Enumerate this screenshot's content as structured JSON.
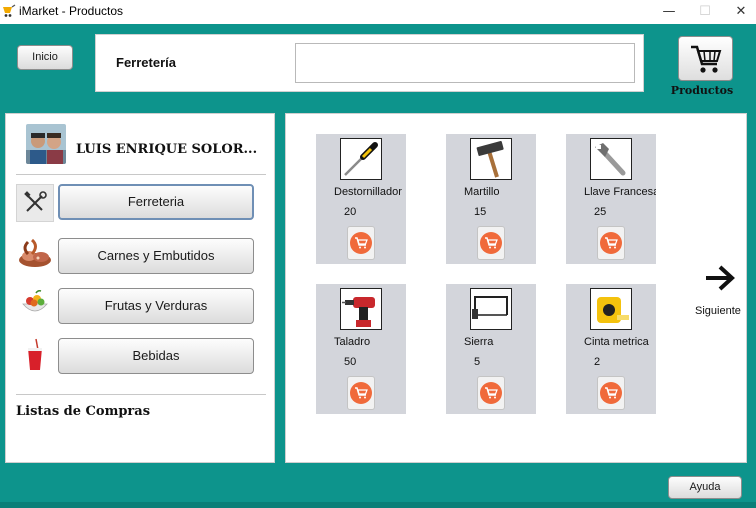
{
  "window": {
    "title": "iMarket - Productos",
    "minimize": "—",
    "maximize": "☐",
    "close": "✕"
  },
  "header": {
    "home_button": "Inicio",
    "section_title": "Ferretería",
    "search_value": "",
    "cart_label": "Productos"
  },
  "sidebar": {
    "user_name": "LUIS ENRIQUE  SOLOR...",
    "categories": [
      {
        "label": "Ferreteria",
        "icon": "tools-icon",
        "active": true
      },
      {
        "label": "Carnes y Embutidos",
        "icon": "meat-icon",
        "active": false
      },
      {
        "label": "Frutas y Verduras",
        "icon": "fruits-icon",
        "active": false
      },
      {
        "label": "Bebidas",
        "icon": "drink-icon",
        "active": false
      }
    ],
    "lists_title": "Listas de Compras"
  },
  "products": [
    {
      "name": "Destornillador",
      "qty": "20",
      "icon": "screwdriver-icon"
    },
    {
      "name": "Martillo",
      "qty": "15",
      "icon": "hammer-icon"
    },
    {
      "name": "Llave Francesa",
      "qty": "25",
      "icon": "wrench-icon"
    },
    {
      "name": "Taladro",
      "qty": "50",
      "icon": "drill-icon"
    },
    {
      "name": "Sierra",
      "qty": "5",
      "icon": "saw-icon"
    },
    {
      "name": "Cinta metrica",
      "qty": "2",
      "icon": "tape-measure-icon"
    }
  ],
  "navigation": {
    "next_label": "Siguiente"
  },
  "footer": {
    "help_button": "Ayuda"
  },
  "colors": {
    "frame": "#0d948c",
    "card": "#d3d5db",
    "cart_accent": "#f06a3b"
  }
}
